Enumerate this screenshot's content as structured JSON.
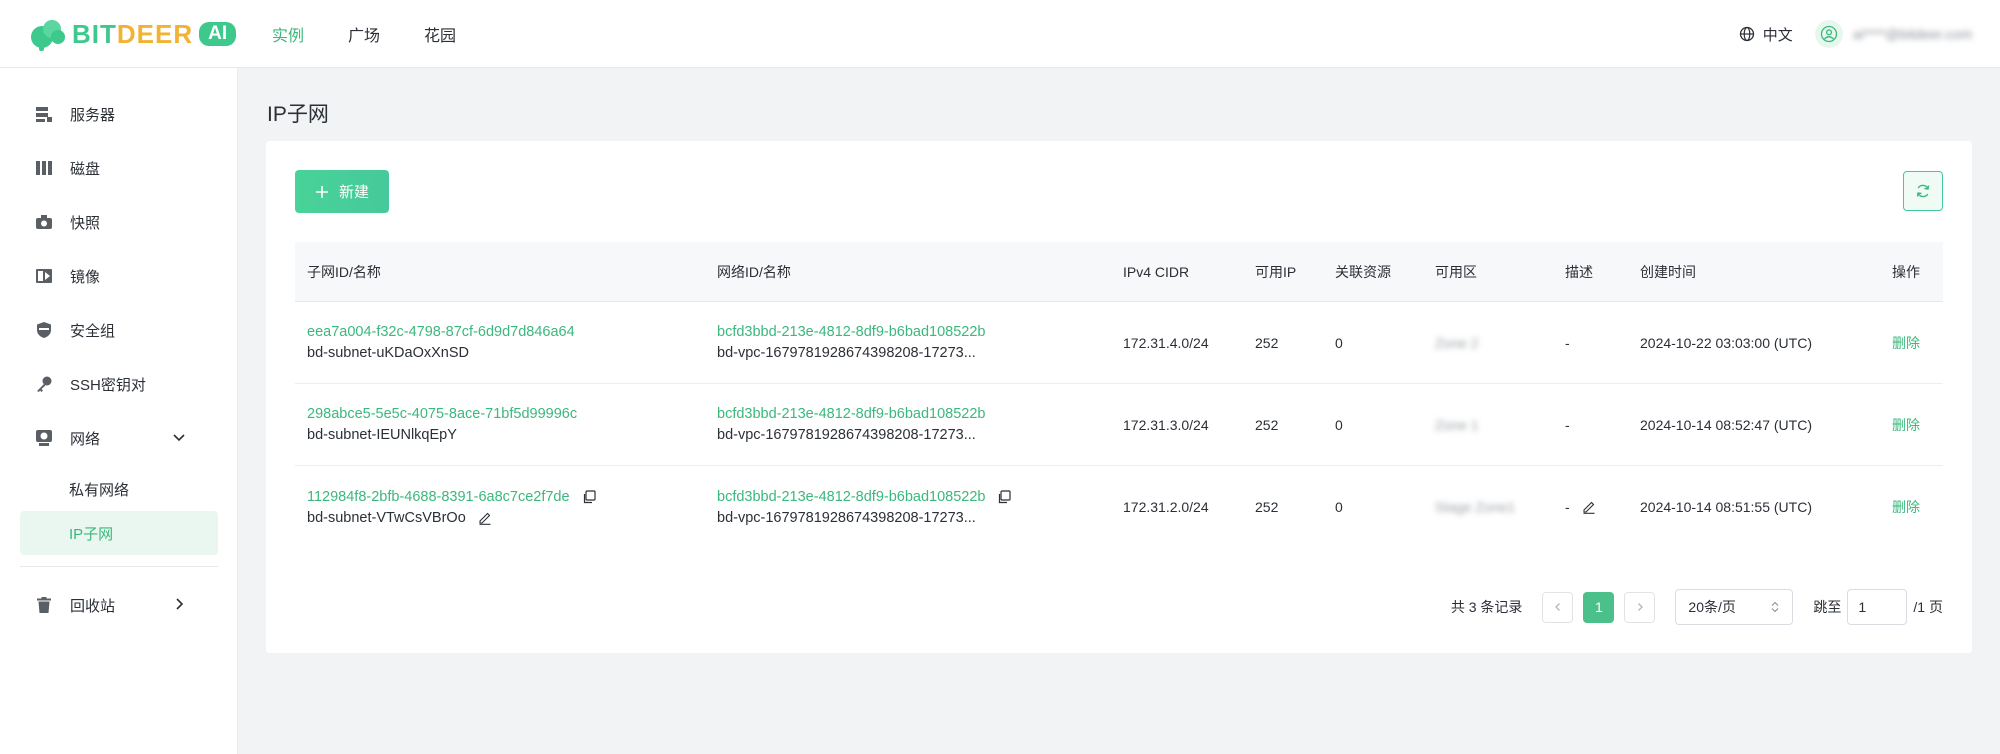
{
  "brand": {
    "text_bit": "BITDEER",
    "text_ai": "AI",
    "color_primary": "#3dc98b",
    "color_secondary": "#f2b233"
  },
  "topnav": [
    {
      "label": "实例",
      "active": true
    },
    {
      "label": "广场",
      "active": false
    },
    {
      "label": "花园",
      "active": false
    }
  ],
  "header": {
    "language": "中文",
    "user_email": "ai****@bitdeer.com"
  },
  "sidebar": {
    "items": [
      {
        "label": "服务器",
        "icon": "server-icon"
      },
      {
        "label": "磁盘",
        "icon": "disk-icon"
      },
      {
        "label": "快照",
        "icon": "camera-icon"
      },
      {
        "label": "镜像",
        "icon": "image-icon"
      },
      {
        "label": "安全组",
        "icon": "shield-icon"
      },
      {
        "label": "SSH密钥对",
        "icon": "key-icon"
      },
      {
        "label": "网络",
        "icon": "network-icon"
      }
    ],
    "network_sub": [
      {
        "label": "私有网络",
        "active": false
      },
      {
        "label": "IP子网",
        "active": true
      }
    ],
    "recycle": {
      "label": "回收站",
      "icon": "trash-icon"
    }
  },
  "page": {
    "title": "IP子网",
    "new_button": "新建"
  },
  "table": {
    "headers": [
      "子网ID/名称",
      "网络ID/名称",
      "IPv4 CIDR",
      "可用IP",
      "关联资源",
      "可用区",
      "描述",
      "创建时间",
      "操作"
    ],
    "rows": [
      {
        "subnet_id": "eea7a004-f32c-4798-87cf-6d9d7d846a64",
        "subnet_name": "bd-subnet-uKDaOxXnSD",
        "network_id": "bcfd3bbd-213e-4812-8df9-b6bad108522b",
        "network_name": "bd-vpc-1679781928674398208-17273...",
        "cidr": "172.31.4.0/24",
        "available_ip": "252",
        "resources": "0",
        "zone": "Zone 2",
        "desc": "-",
        "created": "2024-10-22 03:03:00 (UTC)",
        "action": "删除"
      },
      {
        "subnet_id": "298abce5-5e5c-4075-8ace-71bf5d99996c",
        "subnet_name": "bd-subnet-IEUNlkqEpY",
        "network_id": "bcfd3bbd-213e-4812-8df9-b6bad108522b",
        "network_name": "bd-vpc-1679781928674398208-17273...",
        "cidr": "172.31.3.0/24",
        "available_ip": "252",
        "resources": "0",
        "zone": "Zone 1",
        "desc": "-",
        "created": "2024-10-14 08:52:47 (UTC)",
        "action": "删除"
      },
      {
        "subnet_id": "112984f8-2bfb-4688-8391-6a8c7ce2f7de",
        "subnet_name": "bd-subnet-VTwCsVBrOo",
        "network_id": "bcfd3bbd-213e-4812-8df9-b6bad108522b",
        "network_name": "bd-vpc-1679781928674398208-17273...",
        "cidr": "172.31.2.0/24",
        "available_ip": "252",
        "resources": "0",
        "zone": "Stage Zone1",
        "desc": "-",
        "created": "2024-10-14 08:51:55 (UTC)",
        "action": "删除"
      }
    ]
  },
  "pagination": {
    "total": "共 3 条记录",
    "current_page": "1",
    "page_size": "20条/页",
    "jump_label": "跳至",
    "jump_value": "1",
    "total_pages": "/1 页"
  }
}
